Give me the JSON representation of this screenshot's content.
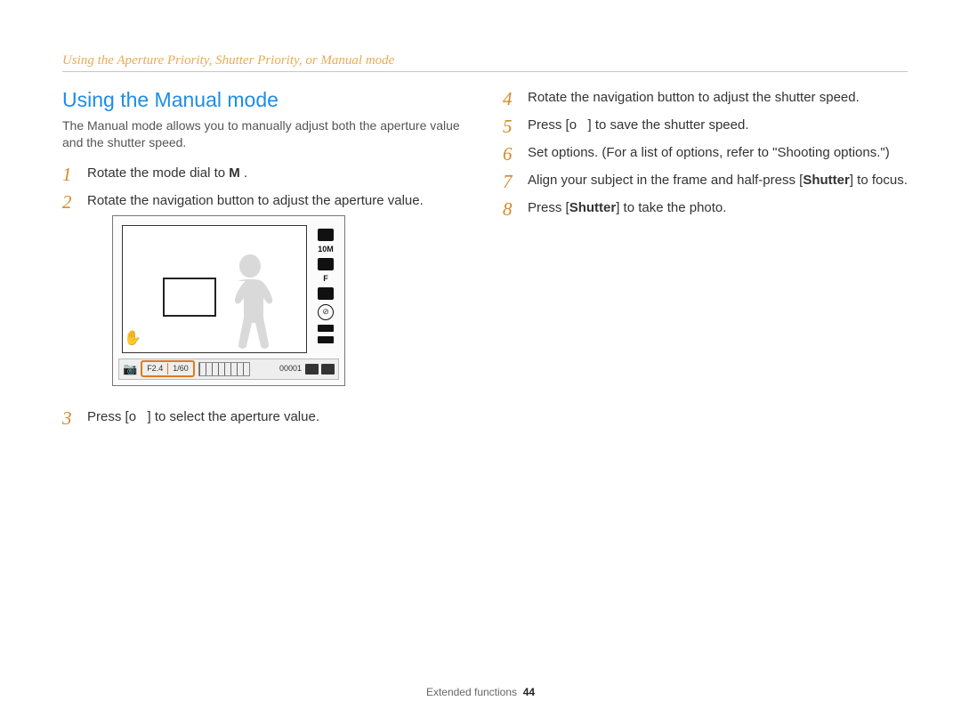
{
  "header": {
    "breadcrumb": "Using the Aperture Priority, Shutter Priority, or Manual mode"
  },
  "section": {
    "title": "Using the Manual mode",
    "intro": "The Manual mode allows you to manually adjust both the aperture value and the shutter speed."
  },
  "steps_left": {
    "s1_pre": "Rotate the mode dial to ",
    "s1_mode": "M",
    "s1_post": " .",
    "s2": "Rotate the navigation button to adjust the aperture value.",
    "s3_pre": "Press [",
    "s3_btn": "o",
    "s3_post": "] to select the aperture value."
  },
  "steps_right": {
    "s4": "Rotate the navigation button to adjust the shutter speed.",
    "s5_pre": "Press [",
    "s5_btn": "o",
    "s5_post": "] to save the shutter speed.",
    "s6": "Set options. (For a list of options, refer to \"Shooting options.\")",
    "s7_pre": "Align your subject in the frame and half-press [",
    "s7_btn": "Shutter",
    "s7_post": "] to focus.",
    "s8_pre": "Press [",
    "s8_btn": "Shutter",
    "s8_post": "] to take the photo."
  },
  "screen": {
    "aperture": "F2.4",
    "shutter": "1/60",
    "counter": "00001",
    "res_label": "10M",
    "fine_label": "F",
    "flash_glyph": "⊘"
  },
  "footer": {
    "section": "Extended functions",
    "page": "44"
  }
}
